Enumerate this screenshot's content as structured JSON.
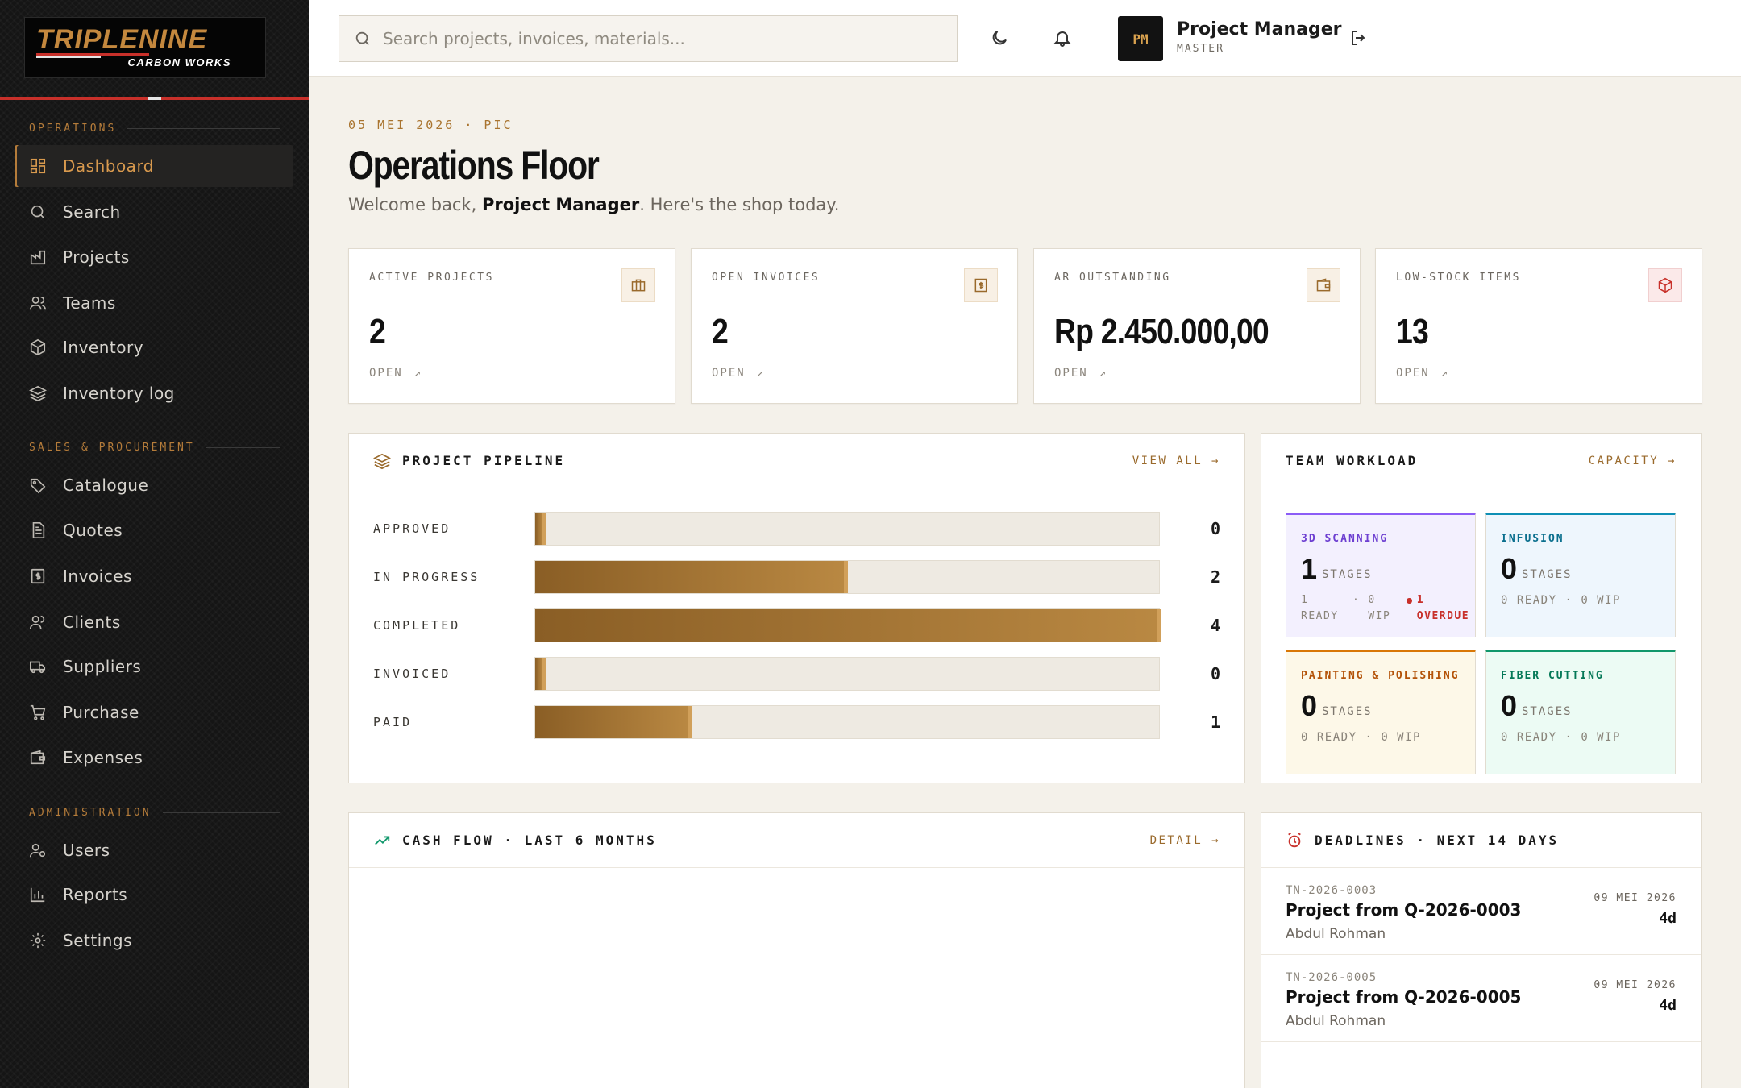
{
  "brand": {
    "name": "TRIPLENINE",
    "tagline": "CARBON WORKS"
  },
  "sidebar": {
    "sections": [
      {
        "label": "OPERATIONS",
        "items": [
          {
            "label": "Dashboard",
            "icon": "dashboard-icon",
            "active": true
          },
          {
            "label": "Search",
            "icon": "search-icon"
          },
          {
            "label": "Projects",
            "icon": "factory-icon"
          },
          {
            "label": "Teams",
            "icon": "users-icon"
          },
          {
            "label": "Inventory",
            "icon": "box-icon"
          },
          {
            "label": "Inventory log",
            "icon": "layers-icon"
          }
        ]
      },
      {
        "label": "SALES & PROCUREMENT",
        "items": [
          {
            "label": "Catalogue",
            "icon": "tags-icon"
          },
          {
            "label": "Quotes",
            "icon": "document-icon"
          },
          {
            "label": "Invoices",
            "icon": "dollar-doc-icon"
          },
          {
            "label": "Clients",
            "icon": "clients-icon"
          },
          {
            "label": "Suppliers",
            "icon": "truck-icon"
          },
          {
            "label": "Purchase",
            "icon": "cart-icon"
          },
          {
            "label": "Expenses",
            "icon": "wallet-icon"
          }
        ]
      },
      {
        "label": "ADMINISTRATION",
        "items": [
          {
            "label": "Users",
            "icon": "user-gear-icon"
          },
          {
            "label": "Reports",
            "icon": "bar-chart-icon"
          },
          {
            "label": "Settings",
            "icon": "gear-icon"
          }
        ]
      }
    ]
  },
  "topbar": {
    "search_placeholder": "Search projects, invoices, materials...",
    "user": {
      "initials": "PM",
      "name": "Project Manager",
      "role": "MASTER"
    }
  },
  "header": {
    "date_line": "05 MEI 2026 · PIC",
    "title": "Operations Floor",
    "welcome_prefix": "Welcome back, ",
    "welcome_name": "Project Manager",
    "welcome_suffix": ". Here's the shop today."
  },
  "stats": [
    {
      "label": "ACTIVE PROJECTS",
      "value": "2",
      "link": "OPEN",
      "icon": "briefcase-icon"
    },
    {
      "label": "OPEN INVOICES",
      "value": "2",
      "link": "OPEN",
      "icon": "dollar-doc-icon"
    },
    {
      "label": "AR OUTSTANDING",
      "value": "Rp 2.450.000,00",
      "link": "OPEN",
      "icon": "wallet-icon"
    },
    {
      "label": "LOW-STOCK ITEMS",
      "value": "13",
      "link": "OPEN",
      "icon": "box-icon"
    }
  ],
  "pipeline": {
    "title": "PROJECT PIPELINE",
    "link": "VIEW ALL →",
    "max": 4,
    "rows": [
      {
        "label": "APPROVED",
        "count": 0
      },
      {
        "label": "IN PROGRESS",
        "count": 2
      },
      {
        "label": "COMPLETED",
        "count": 4
      },
      {
        "label": "INVOICED",
        "count": 0
      },
      {
        "label": "PAID",
        "count": 1
      }
    ]
  },
  "workload": {
    "title": "TEAM WORKLOAD",
    "link": "CAPACITY →",
    "stages_label": "STAGES",
    "teams": [
      {
        "name": "3D SCANNING",
        "count": "1",
        "ready": "1 READY",
        "wip": "0 WIP",
        "overdue": "1 OVERDUE",
        "accent": "#8b5cf6",
        "bg": "#f3f0fe",
        "name_color": "#6d3fd1"
      },
      {
        "name": "INFUSION",
        "count": "0",
        "ready": "0 READY",
        "wip": "0 WIP",
        "accent": "#0e8fb5",
        "bg": "#eef6fd",
        "name_color": "#0a6f8e"
      },
      {
        "name": "PAINTING & POLISHING",
        "count": "0",
        "ready": "0 READY",
        "wip": "0 WIP",
        "accent": "#d97706",
        "bg": "#fdf8e8",
        "name_color": "#b45309"
      },
      {
        "name": "FIBER CUTTING",
        "count": "0",
        "ready": "0 READY",
        "wip": "0 WIP",
        "accent": "#10976b",
        "bg": "#ecfbf4",
        "name_color": "#047857"
      }
    ]
  },
  "cashflow": {
    "title": "CASH FLOW · LAST 6 MONTHS",
    "link": "DETAIL →"
  },
  "deadlines": {
    "title": "DEADLINES · NEXT 14 DAYS",
    "items": [
      {
        "code": "TN-2026-0003",
        "title": "Project from Q-2026-0003",
        "client": "Abdul Rohman",
        "date": "09 MEI 2026",
        "days": "4d"
      },
      {
        "code": "TN-2026-0005",
        "title": "Project from Q-2026-0005",
        "client": "Abdul Rohman",
        "date": "09 MEI 2026",
        "days": "4d"
      }
    ]
  },
  "colors": {
    "accent": "#b57c3a",
    "danger": "#c8302a",
    "sidebar_bg": "#151515",
    "page_bg": "#f4f1ea"
  }
}
